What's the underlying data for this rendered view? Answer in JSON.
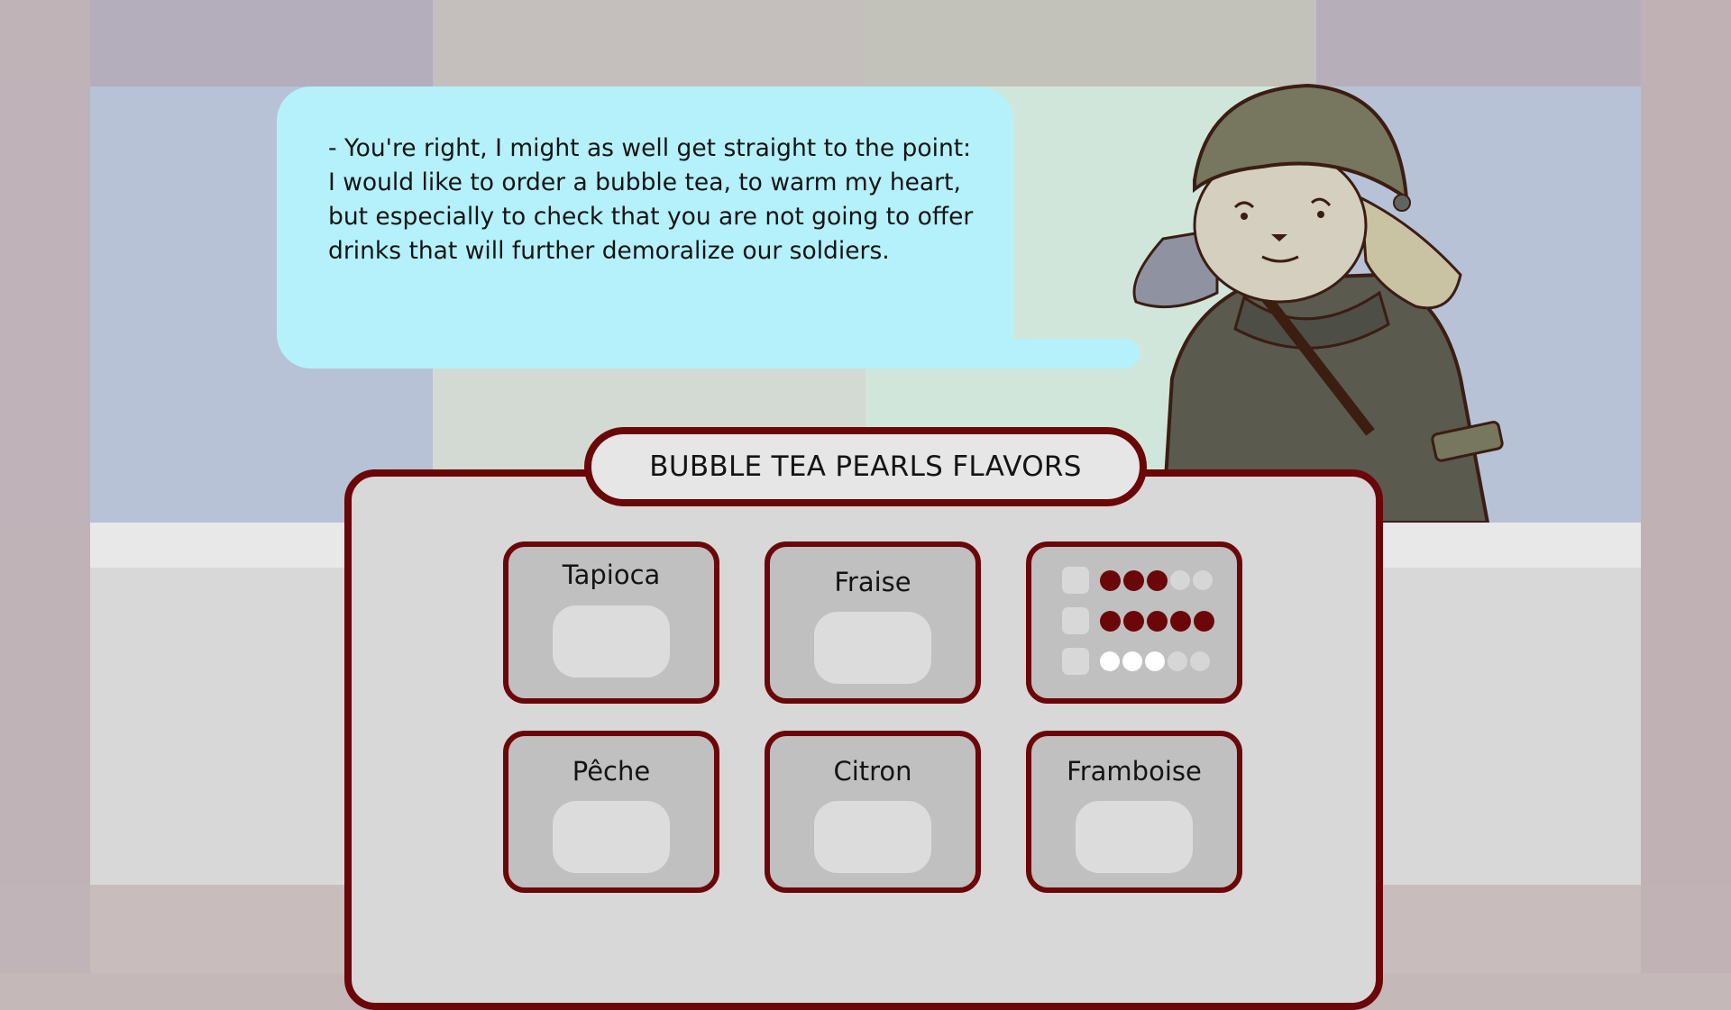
{
  "dialogue": {
    "text": "- You're right, I might as well get straight to the point: I would like to order a bubble tea, to warm my heart, but especially to check that you are not going to offer drinks that will further demoralize our soldiers."
  },
  "panel": {
    "title": "BUBBLE TEA PEARLS FLAVORS"
  },
  "flavors": [
    {
      "label": "Tapioca"
    },
    {
      "label": "Fraise"
    },
    {
      "label": "Pêche"
    },
    {
      "label": "Citron"
    },
    {
      "label": "Framboise"
    }
  ],
  "stats": {
    "rows": [
      {
        "filled": 3,
        "total": 5,
        "style": "dark"
      },
      {
        "filled": 5,
        "total": 5,
        "style": "dark"
      },
      {
        "filled": 3,
        "total": 5,
        "style": "light"
      }
    ]
  },
  "colors": {
    "accent": "#6b0609",
    "bubble": "#b4f1fb",
    "panel": "#d8d8d8",
    "card": "#c0c0c0"
  }
}
